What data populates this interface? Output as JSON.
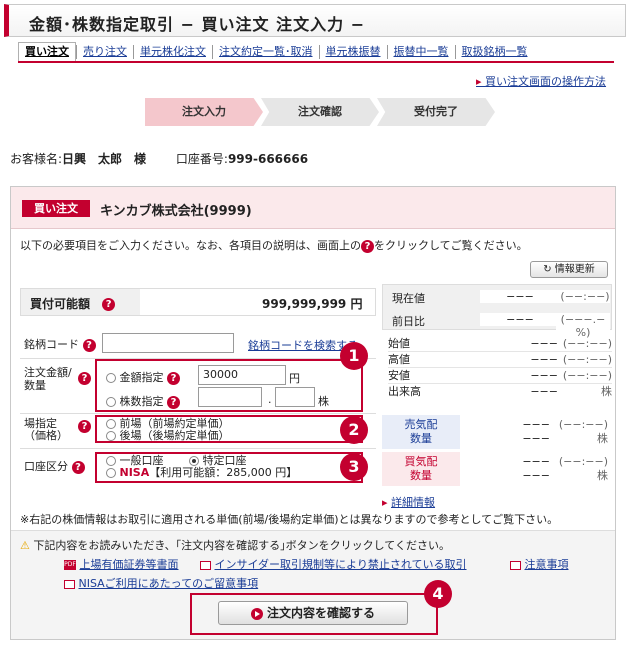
{
  "header": {
    "title": "金額･株数指定取引 − 買い注文 注文入力 −"
  },
  "tabs": [
    "買い注文",
    "売り注文",
    "単元株化注文",
    "注文約定一覧･取消",
    "単元株振替",
    "振替中一覧",
    "取扱銘柄一覧"
  ],
  "help_link": "買い注文画面の操作方法",
  "steps": [
    "注文入力",
    "注文確認",
    "受付完了"
  ],
  "customer": {
    "name_label": "お客様名:",
    "name": "日興　太郎　様",
    "account_label": "口座番号:",
    "account": "999-666666"
  },
  "order": {
    "badge": "買い注文",
    "stock_name": "キンカブ株式会社(9999)"
  },
  "intro": {
    "text_before": "以下の必要項目をご入力ください。なお、各項目の説明は、画面上の",
    "icon": "?",
    "text_after": "をクリックしてご覧ください。"
  },
  "refresh_label": "情報更新",
  "available": {
    "label": "買付可能額",
    "value": "999,999,999 円"
  },
  "form": {
    "code_label": "銘柄コード",
    "code_value": "",
    "code_search": "銘柄コードを検索する",
    "amount_label_1": "注文金額/",
    "amount_label_2": "数量",
    "amount_option": "金額指定",
    "amount_value": "30000",
    "amount_unit": "円",
    "shares_option": "株数指定",
    "shares_sep": ".",
    "shares_unit": "株",
    "market_label_1": "場指定",
    "market_label_2": "（価格）",
    "market_opt1": "前場（前場約定単価）",
    "market_opt2": "後場（後場約定単価）",
    "account_label": "口座区分",
    "account_opt1": "一般口座",
    "account_opt2": "特定口座",
    "nisa_label": "NISA",
    "nisa_info": "【利用可能額：285,000 円】"
  },
  "quote": {
    "current_label": "現在値",
    "current_value": "−−−",
    "current_time": "(−−:−−)",
    "prev_label": "前日比",
    "prev_value": "−−−",
    "prev_pct": "(−−−.−%)",
    "rows": [
      {
        "label": "始値",
        "value": "−−−",
        "time": "(−−:−−)"
      },
      {
        "label": "高値",
        "value": "−−−",
        "time": "(−−:−−)"
      },
      {
        "label": "安値",
        "value": "−−−",
        "time": "(−−:−−)"
      },
      {
        "label": "出来高",
        "value": "−−−",
        "time": "株"
      }
    ],
    "ask_label_1": "売気配",
    "ask_label_2": "数量",
    "ask_value": "−−−",
    "ask_time": "(−−:−−)",
    "ask_qty": "−−−",
    "ask_unit": "株",
    "bid_label_1": "買気配",
    "bid_label_2": "数量",
    "bid_value": "−−−",
    "bid_time": "(−−:−−)",
    "bid_qty": "−−−",
    "bid_unit": "株",
    "detail_link": "詳細情報"
  },
  "note": "※右記の株価情報はお取引に適用される単価(前場/後場約定単価)とは異なりますので参考としてご覧下さい。",
  "warning": "下記内容をお読みいただき、｢注文内容を確認する｣ボタンをクリックしてください。",
  "doc_links": [
    "上場有価証券等書面",
    "インサイダー取引規制等により禁止されている取引",
    "注意事項",
    "NISAご利用にあたってのご留意事項"
  ],
  "pdf_icon_text": "PDF",
  "confirm_button": "注文内容を確認する",
  "callouts": [
    "1",
    "2",
    "3",
    "4"
  ],
  "colors": {
    "accent": "#c3002f",
    "link": "#1a3c96",
    "step_active": "#f4c7cc",
    "panel_head": "#fbe9eb",
    "ask_text": "#1a3c96",
    "bid_text": "#c3002f"
  }
}
